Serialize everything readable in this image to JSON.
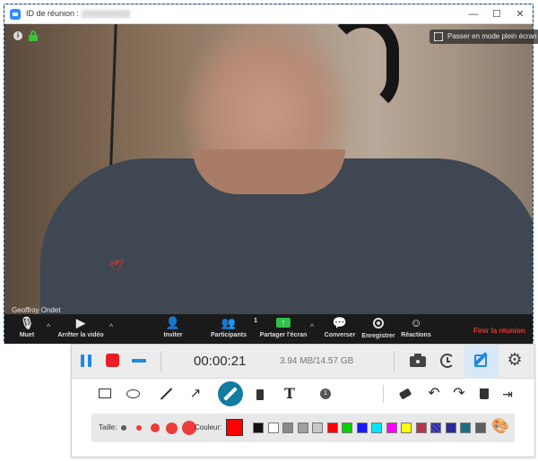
{
  "window": {
    "title": "ID de réunion :",
    "minimize_glyph": "—",
    "maximize_glyph": "☐",
    "close_glyph": "✕"
  },
  "video": {
    "participant_name": "Geoffroy Ondet",
    "fullscreen_label": "Passer en mode plein écran"
  },
  "zoom_controls": {
    "mute": "Muet",
    "stop_video": "Arrêter la vidéo",
    "invite": "Inviter",
    "participants": "Participants",
    "participants_count": "1",
    "share_screen": "Partager l'écran",
    "chat": "Converser",
    "record": "Enregistrer",
    "reactions": "Réactions",
    "end_meeting": "Finir la réunion",
    "end_color": "#e53935"
  },
  "recorder": {
    "timer": "00:00:21",
    "file_size": "3.94 MB/14.57 GB",
    "accent_color": "#1e88e5",
    "stop_color": "#ee1c25",
    "active_tool": "pen",
    "size_label": "Taille:",
    "color_label": "Couleur:",
    "current_color": "#ff0000",
    "swatches": [
      "#111111",
      "#ffffff",
      "#8a8a8a",
      "#a0a0a0",
      "#c8c8c8",
      "#ff0000",
      "#00d000",
      "#1a1aff",
      "#00e5ff",
      "#ff00ff",
      "#ffff00",
      "#b23a48",
      "#7b1f1f",
      "#2a2a9a",
      "#1a6e8a",
      "#5f5f5f"
    ],
    "icons": [
      "pause-icon",
      "stop-icon",
      "minimize-icon",
      "camera-icon",
      "schedule-icon",
      "annotate-icon",
      "gear-icon",
      "rectangle-icon",
      "ellipse-icon",
      "line-icon",
      "arrow-icon",
      "pen-icon",
      "marker-icon",
      "text-icon",
      "step-icon",
      "eraser-icon",
      "undo-icon",
      "redo-icon",
      "trash-icon",
      "exit-icon",
      "palette-icon"
    ]
  }
}
